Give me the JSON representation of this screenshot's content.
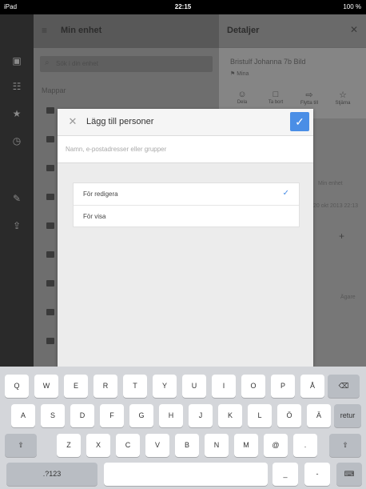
{
  "status_bar": {
    "carrier": "iPad",
    "time": "22:15",
    "battery": "100 %"
  },
  "rail": {
    "icons": [
      "folder-icon",
      "people-icon",
      "star-icon",
      "clock-icon",
      "pin-icon",
      "upload-icon"
    ]
  },
  "list_pane": {
    "title": "Min enhet",
    "search_placeholder": "Sök i din enhet",
    "section_label": "Mappar"
  },
  "detail_pane": {
    "title": "Detaljer",
    "file_name": "Bristulf Johanna 7b Bild",
    "owner_label": "Mina",
    "actions": [
      {
        "label": "Dela",
        "icon": "share-person-icon"
      },
      {
        "label": "Ta bort",
        "icon": "trash-icon"
      },
      {
        "label": "Flytta till",
        "icon": "move-icon"
      },
      {
        "label": "Stjärna",
        "icon": "star-icon"
      }
    ],
    "side_texts": [
      "Min enhet",
      "20 okt 2013 22:13",
      "Ägare"
    ]
  },
  "modal": {
    "title": "Lägg till personer",
    "input_placeholder": "Namn, e-postadresser eller grupper",
    "permissions": [
      {
        "label": "För redigera",
        "selected": true
      },
      {
        "label": "För visa",
        "selected": false
      }
    ]
  },
  "keyboard": {
    "row1": [
      "Q",
      "W",
      "E",
      "R",
      "T",
      "Y",
      "U",
      "I",
      "O",
      "P",
      "Å"
    ],
    "row2": [
      "A",
      "S",
      "D",
      "F",
      "G",
      "H",
      "J",
      "K",
      "L",
      "Ö",
      "Ä"
    ],
    "row3": [
      "Z",
      "X",
      "C",
      "V",
      "B",
      "N",
      "M",
      "@",
      "."
    ],
    "return_label": "retur",
    "numbers_label": ".?123",
    "underscore_label": "_",
    "dash_label": "-",
    "shift_glyph": "⇧",
    "backspace_glyph": "⌫",
    "keyboard_glyph": "⌨"
  },
  "colors": {
    "accent": "#4a8ee6",
    "modal_bg": "#ececec",
    "keyboard_bg": "#d4d6da"
  }
}
